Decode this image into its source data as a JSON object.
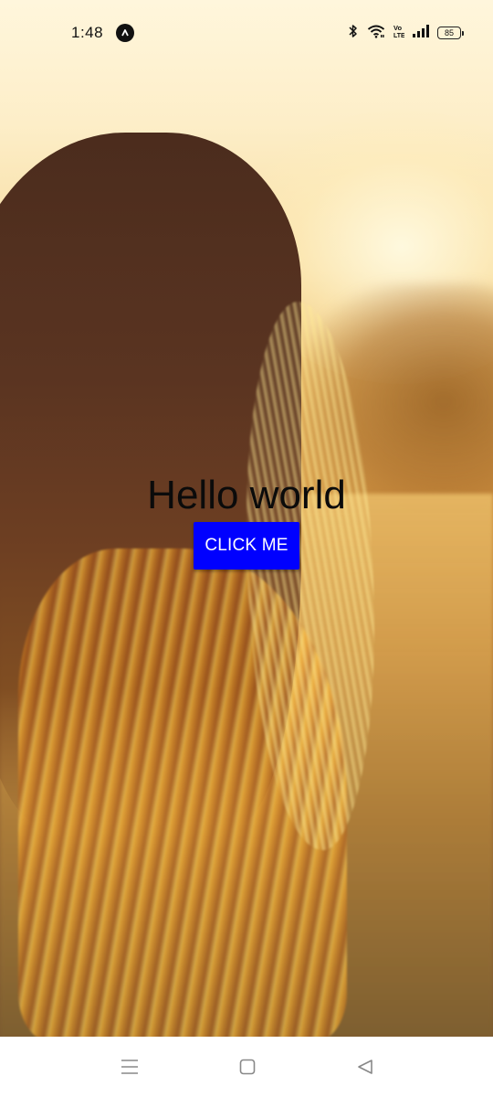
{
  "status_bar": {
    "time": "1:48",
    "battery_level": "85",
    "icons": [
      "app-notification-icon",
      "bluetooth-icon",
      "wifi-icon",
      "volte-icon",
      "signal-icon",
      "battery-icon"
    ]
  },
  "background": {
    "icon": "photo-background",
    "accent_colors": [
      "#fdeec8",
      "#e9b863",
      "#5a3421"
    ]
  },
  "main": {
    "greeting": "Hello world",
    "button_label": "CLICK ME",
    "button_color": "#0000ff"
  },
  "nav_bar": {
    "icons": [
      "menu-icon",
      "home-icon",
      "back-icon"
    ]
  }
}
